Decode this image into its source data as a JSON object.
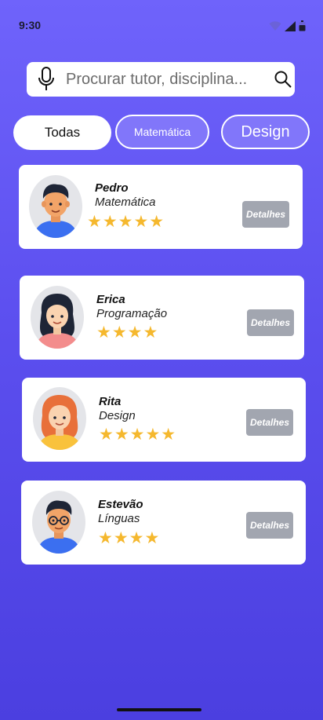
{
  "status_bar": {
    "time": "9:30"
  },
  "search": {
    "placeholder": "Procurar tutor, disciplina..."
  },
  "filters": [
    {
      "label": "Todas",
      "selected": true
    },
    {
      "label": "Matemática",
      "selected": false
    },
    {
      "label": "Design",
      "selected": false
    }
  ],
  "tutors": [
    {
      "name": "Pedro",
      "subject": "Matemática",
      "stars": "★★★★★",
      "rating": 5,
      "button": "Detalhes"
    },
    {
      "name": "Erica",
      "subject": "Programação",
      "stars": "★★★★",
      "rating": 4,
      "button": "Detalhes"
    },
    {
      "name": "Rita",
      "subject": "Design",
      "stars": "★★★★★",
      "rating": 5,
      "button": "Detalhes"
    },
    {
      "name": "Estevão",
      "subject": "Línguas",
      "stars": "★★★★",
      "rating": 4,
      "button": "Detalhes"
    }
  ],
  "colors": {
    "background_top": "#6F63FB",
    "background_bottom": "#4B3FE0",
    "chip_active_bg": "#FFFFFF",
    "chip_inactive_bg": "#8176FA",
    "star": "#F5B82E",
    "details_button": "#A2A6B0"
  },
  "icons": [
    "wifi-icon",
    "signal-icon",
    "battery-icon",
    "microphone-icon",
    "search-icon"
  ]
}
